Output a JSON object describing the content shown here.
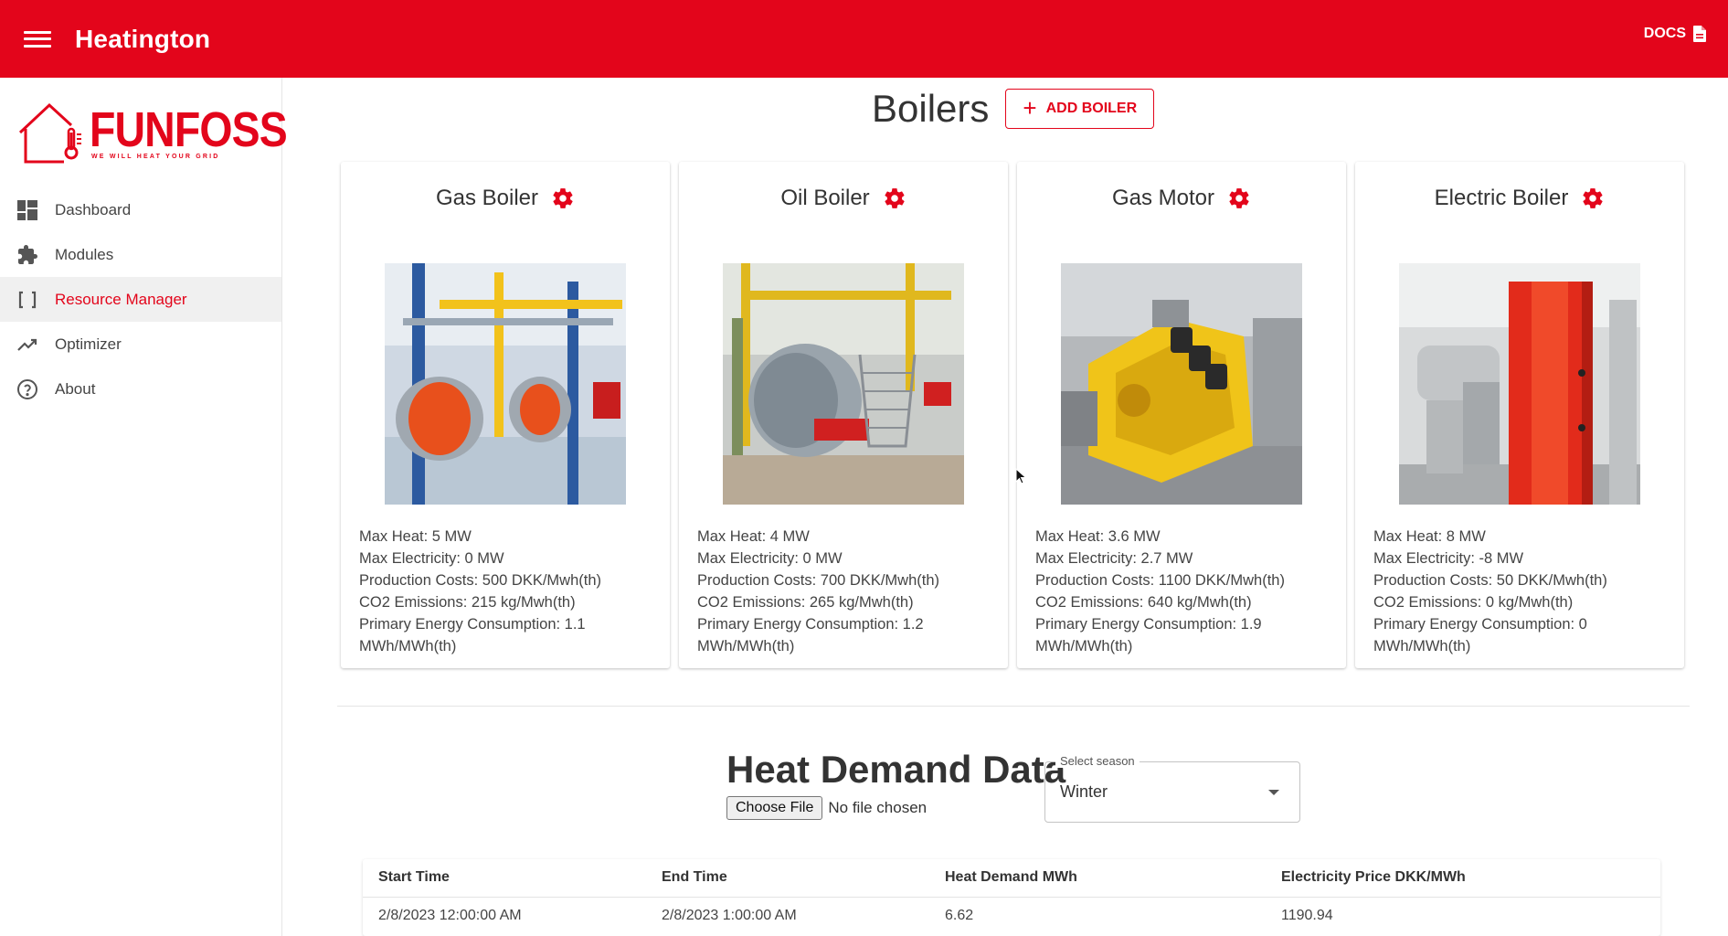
{
  "app": {
    "title": "Heatington",
    "docs_label": "DOCS"
  },
  "brand": {
    "name": "FUNFOSS",
    "tagline": "WE WILL HEAT YOUR GRID"
  },
  "sidebar": {
    "items": [
      {
        "label": "Dashboard",
        "icon": "dashboard-icon",
        "active": false
      },
      {
        "label": "Modules",
        "icon": "puzzle-icon",
        "active": false
      },
      {
        "label": "Resource Manager",
        "icon": "brackets-icon",
        "active": true
      },
      {
        "label": "Optimizer",
        "icon": "trending-up-icon",
        "active": false
      },
      {
        "label": "About",
        "icon": "help-circle-icon",
        "active": false
      }
    ]
  },
  "boilers": {
    "title": "Boilers",
    "add_label": "ADD BOILER",
    "cards": [
      {
        "name": "Gas Boiler",
        "max_heat": "Max Heat: 5 MW",
        "max_electricity": "Max Electricity: 0 MW",
        "production_costs": "Production Costs: 500 DKK/Mwh(th)",
        "co2": "CO2 Emissions: 215 kg/Mwh(th)",
        "primary_energy": "Primary Energy Consumption: 1.1 MWh/MWh(th)"
      },
      {
        "name": "Oil Boiler",
        "max_heat": "Max Heat: 4 MW",
        "max_electricity": "Max Electricity: 0 MW",
        "production_costs": "Production Costs: 700 DKK/Mwh(th)",
        "co2": "CO2 Emissions: 265 kg/Mwh(th)",
        "primary_energy": "Primary Energy Consumption: 1.2 MWh/MWh(th)"
      },
      {
        "name": "Gas Motor",
        "max_heat": "Max Heat: 3.6 MW",
        "max_electricity": "Max Electricity: 2.7 MW",
        "production_costs": "Production Costs: 1100 DKK/Mwh(th)",
        "co2": "CO2 Emissions: 640 kg/Mwh(th)",
        "primary_energy": "Primary Energy Consumption: 1.9 MWh/MWh(th)"
      },
      {
        "name": "Electric Boiler",
        "max_heat": "Max Heat: 8 MW",
        "max_electricity": "Max Electricity: -8 MW",
        "production_costs": "Production Costs: 50 DKK/Mwh(th)",
        "co2": "CO2 Emissions: 0 kg/Mwh(th)",
        "primary_energy": "Primary Energy Consumption: 0 MWh/MWh(th)"
      }
    ]
  },
  "heat_demand": {
    "title": "Heat Demand Data",
    "choose_file_label": "Choose File",
    "file_status": "No file chosen",
    "season_label": "Select season",
    "season_value": "Winter",
    "columns": [
      "Start Time",
      "End Time",
      "Heat Demand MWh",
      "Electricity Price DKK/MWh"
    ],
    "rows": [
      [
        "2/8/2023 12:00:00 AM",
        "2/8/2023 1:00:00 AM",
        "6.62",
        "1190.94"
      ]
    ]
  },
  "colors": {
    "primary": "#e3051b",
    "active_bg": "#f0f0f0"
  }
}
